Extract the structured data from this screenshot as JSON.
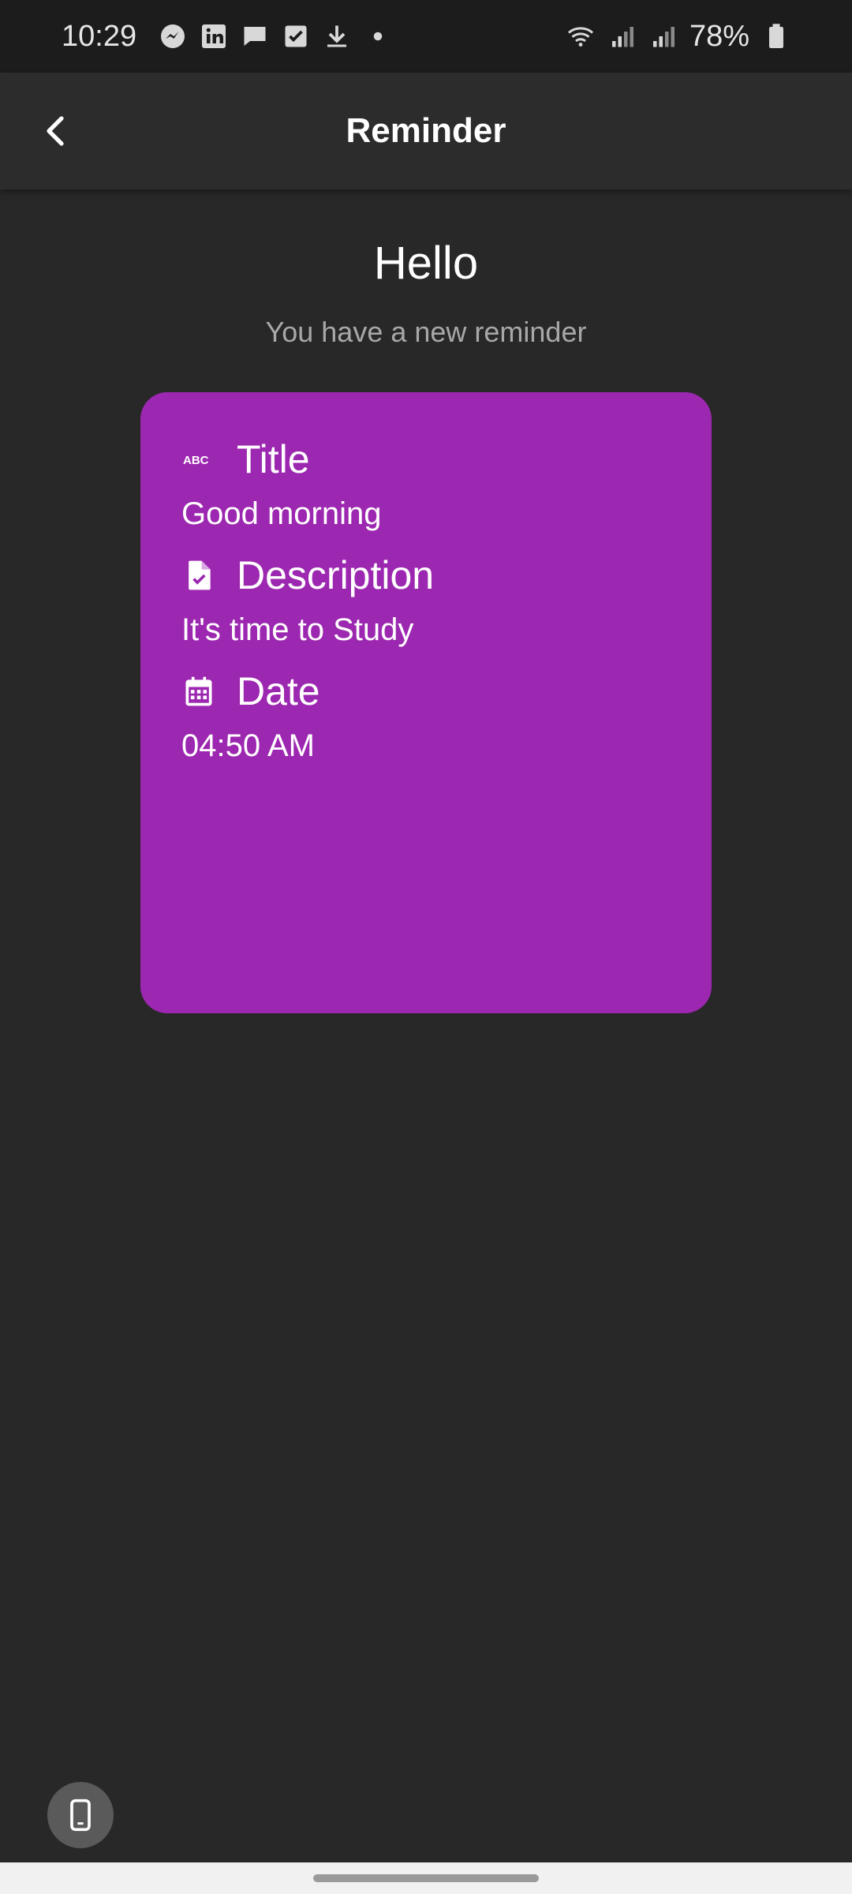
{
  "status_bar": {
    "time": "10:29",
    "battery_percent": "78%",
    "icons_left": [
      "messenger-icon",
      "linkedin-icon",
      "message-icon",
      "checkbox-icon",
      "download-icon",
      "dot-icon"
    ],
    "icons_right": [
      "wifi-icon",
      "signal-icon",
      "signal-icon",
      "battery-icon"
    ]
  },
  "app_bar": {
    "title": "Reminder",
    "back_icon": "chevron-left-icon"
  },
  "main": {
    "greeting": "Hello",
    "subtitle": "You have a new reminder"
  },
  "card": {
    "background": "#9c27b0",
    "rows": [
      {
        "icon": "abc-icon",
        "label": "Title",
        "value": "Good morning"
      },
      {
        "icon": "document-check-icon",
        "label": "Description",
        "value": "It's time to Study"
      },
      {
        "icon": "calendar-icon",
        "label": "Date",
        "value": "04:50 AM"
      }
    ]
  },
  "floating": {
    "icon": "phone-icon"
  }
}
